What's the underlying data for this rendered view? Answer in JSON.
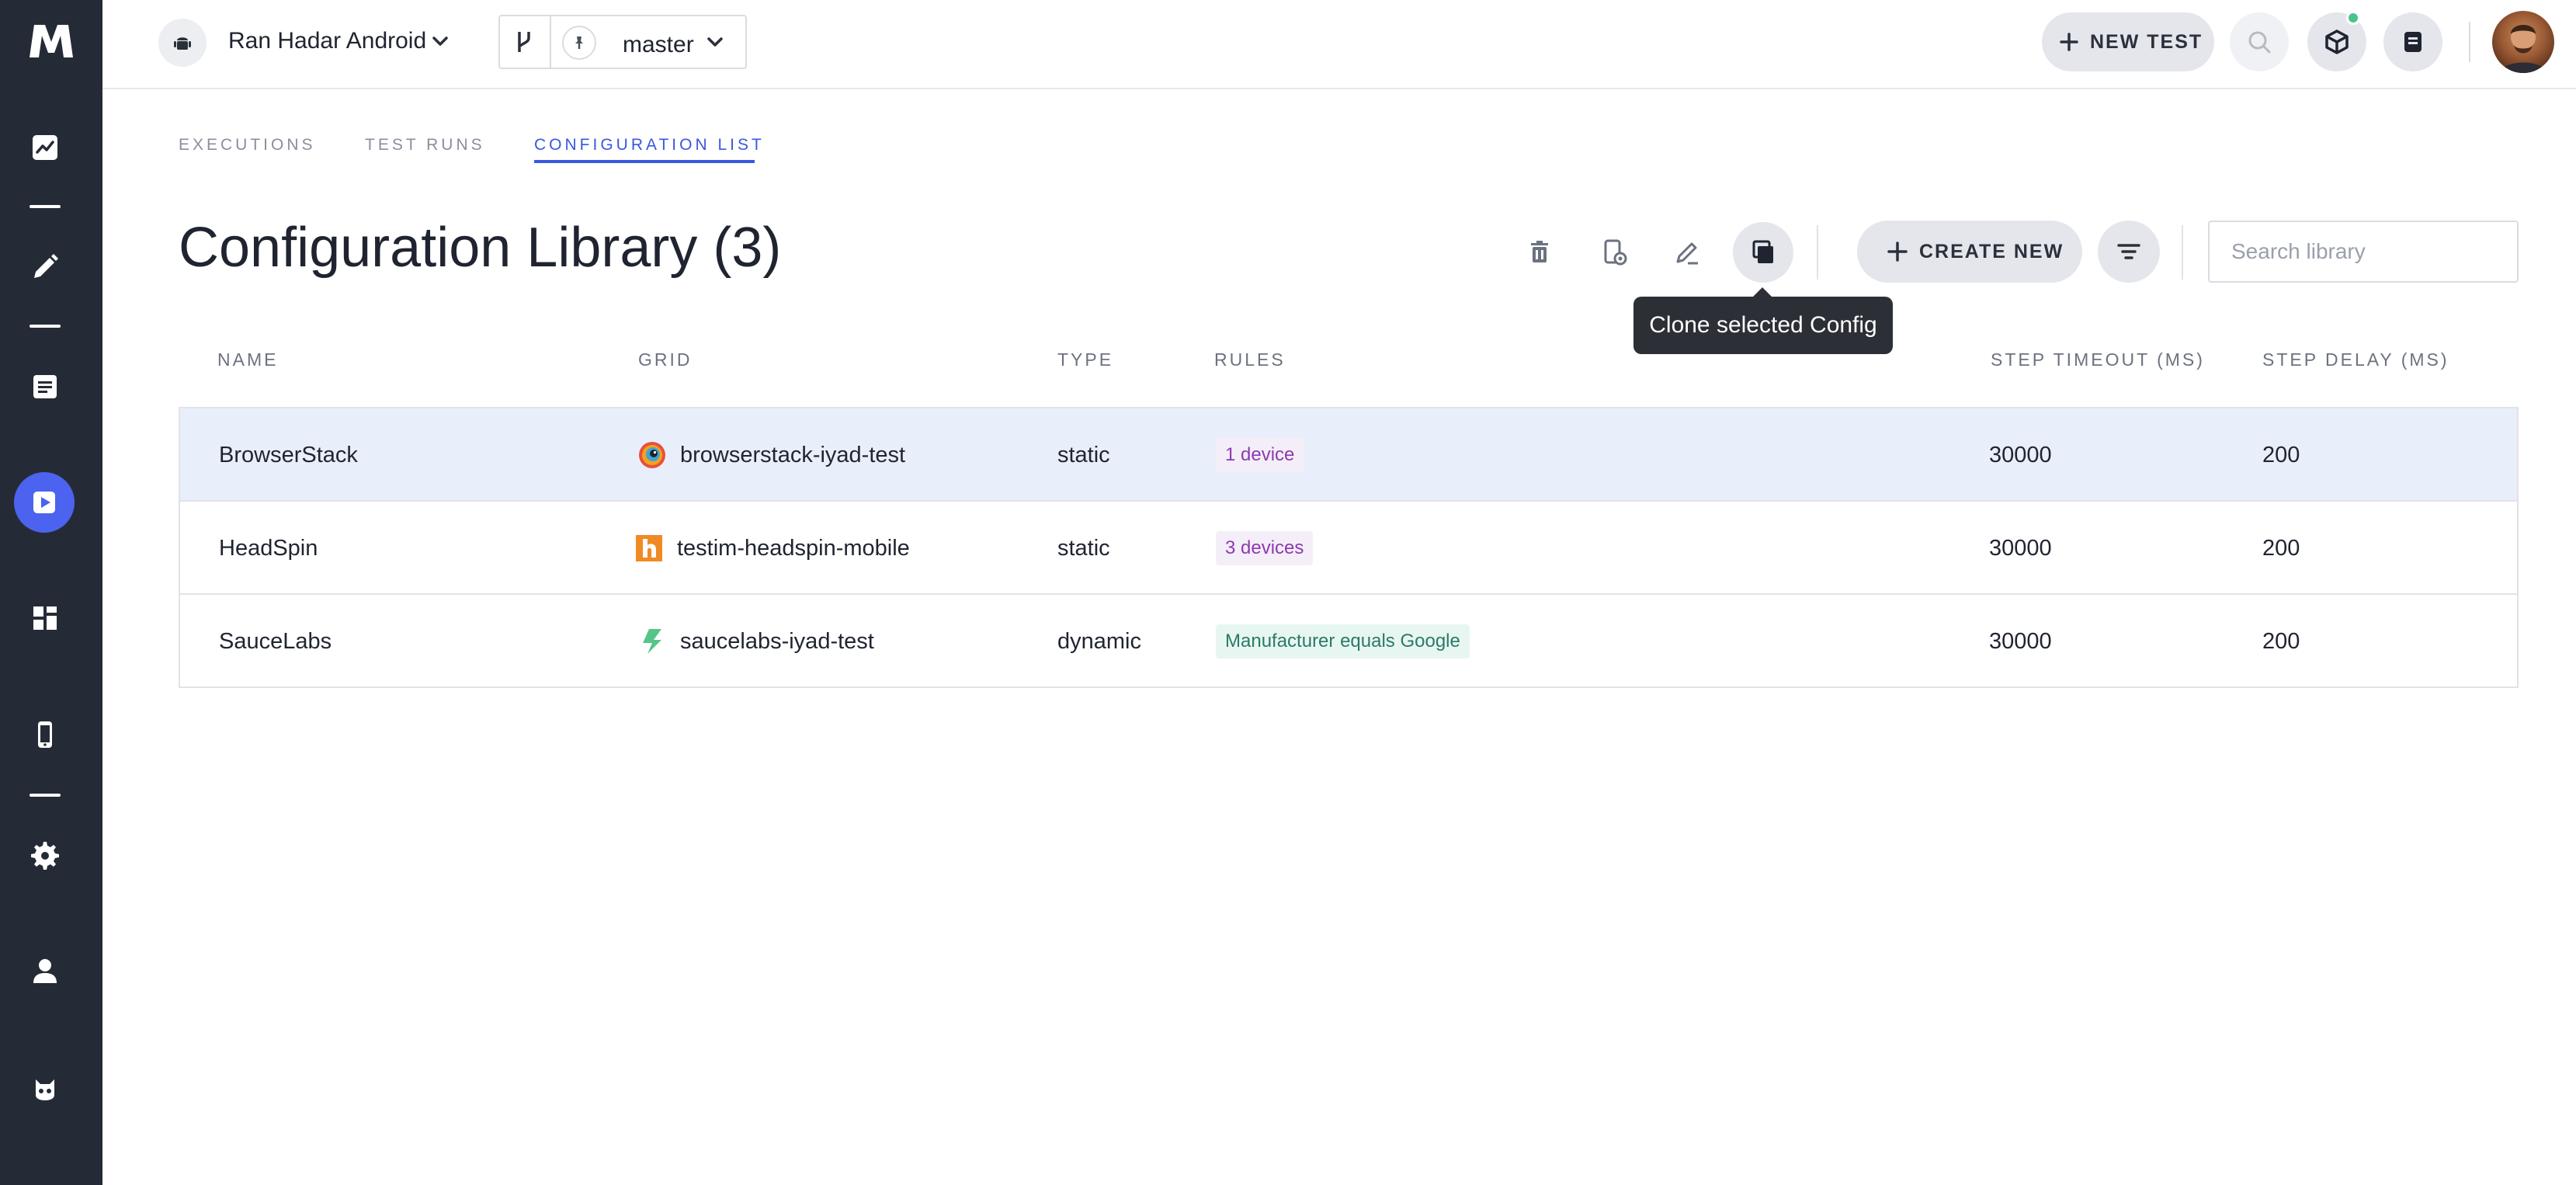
{
  "app": {
    "logo_text": "M"
  },
  "header": {
    "project_name": "Ran Hadar Android",
    "branch_name": "master",
    "new_test_label": "NEW TEST"
  },
  "tabs": [
    {
      "label": "EXECUTIONS"
    },
    {
      "label": "TEST RUNS"
    },
    {
      "label": "CONFIGURATION LIST"
    }
  ],
  "main": {
    "title": "Configuration Library (3)",
    "create_label": "CREATE NEW",
    "search_placeholder": "Search library",
    "tooltip": "Clone selected Config"
  },
  "table": {
    "columns": [
      "NAME",
      "GRID",
      "TYPE",
      "RULES",
      "STEP TIMEOUT (MS)",
      "STEP DELAY (MS)"
    ],
    "rows": [
      {
        "name": "BrowserStack",
        "grid": "browserstack-iyad-test",
        "grid_icon": "browserstack-icon",
        "type": "static",
        "rule": "1 device",
        "timeout": "30000",
        "delay": "200"
      },
      {
        "name": "HeadSpin",
        "grid": "testim-headspin-mobile",
        "grid_icon": "headspin-icon",
        "type": "static",
        "rule": "3 devices",
        "timeout": "30000",
        "delay": "200"
      },
      {
        "name": "SauceLabs",
        "grid": "saucelabs-iyad-test",
        "grid_icon": "saucelabs-icon",
        "type": "dynamic",
        "rule": "Manufacturer equals Google",
        "timeout": "30000",
        "delay": "200"
      }
    ]
  },
  "colors": {
    "sidebar_bg": "#252b36",
    "accent": "#3a58e0",
    "selected_row": "#e9eefb",
    "chip_purple": "#8e3ab0",
    "chip_teal": "#2b7a66"
  }
}
